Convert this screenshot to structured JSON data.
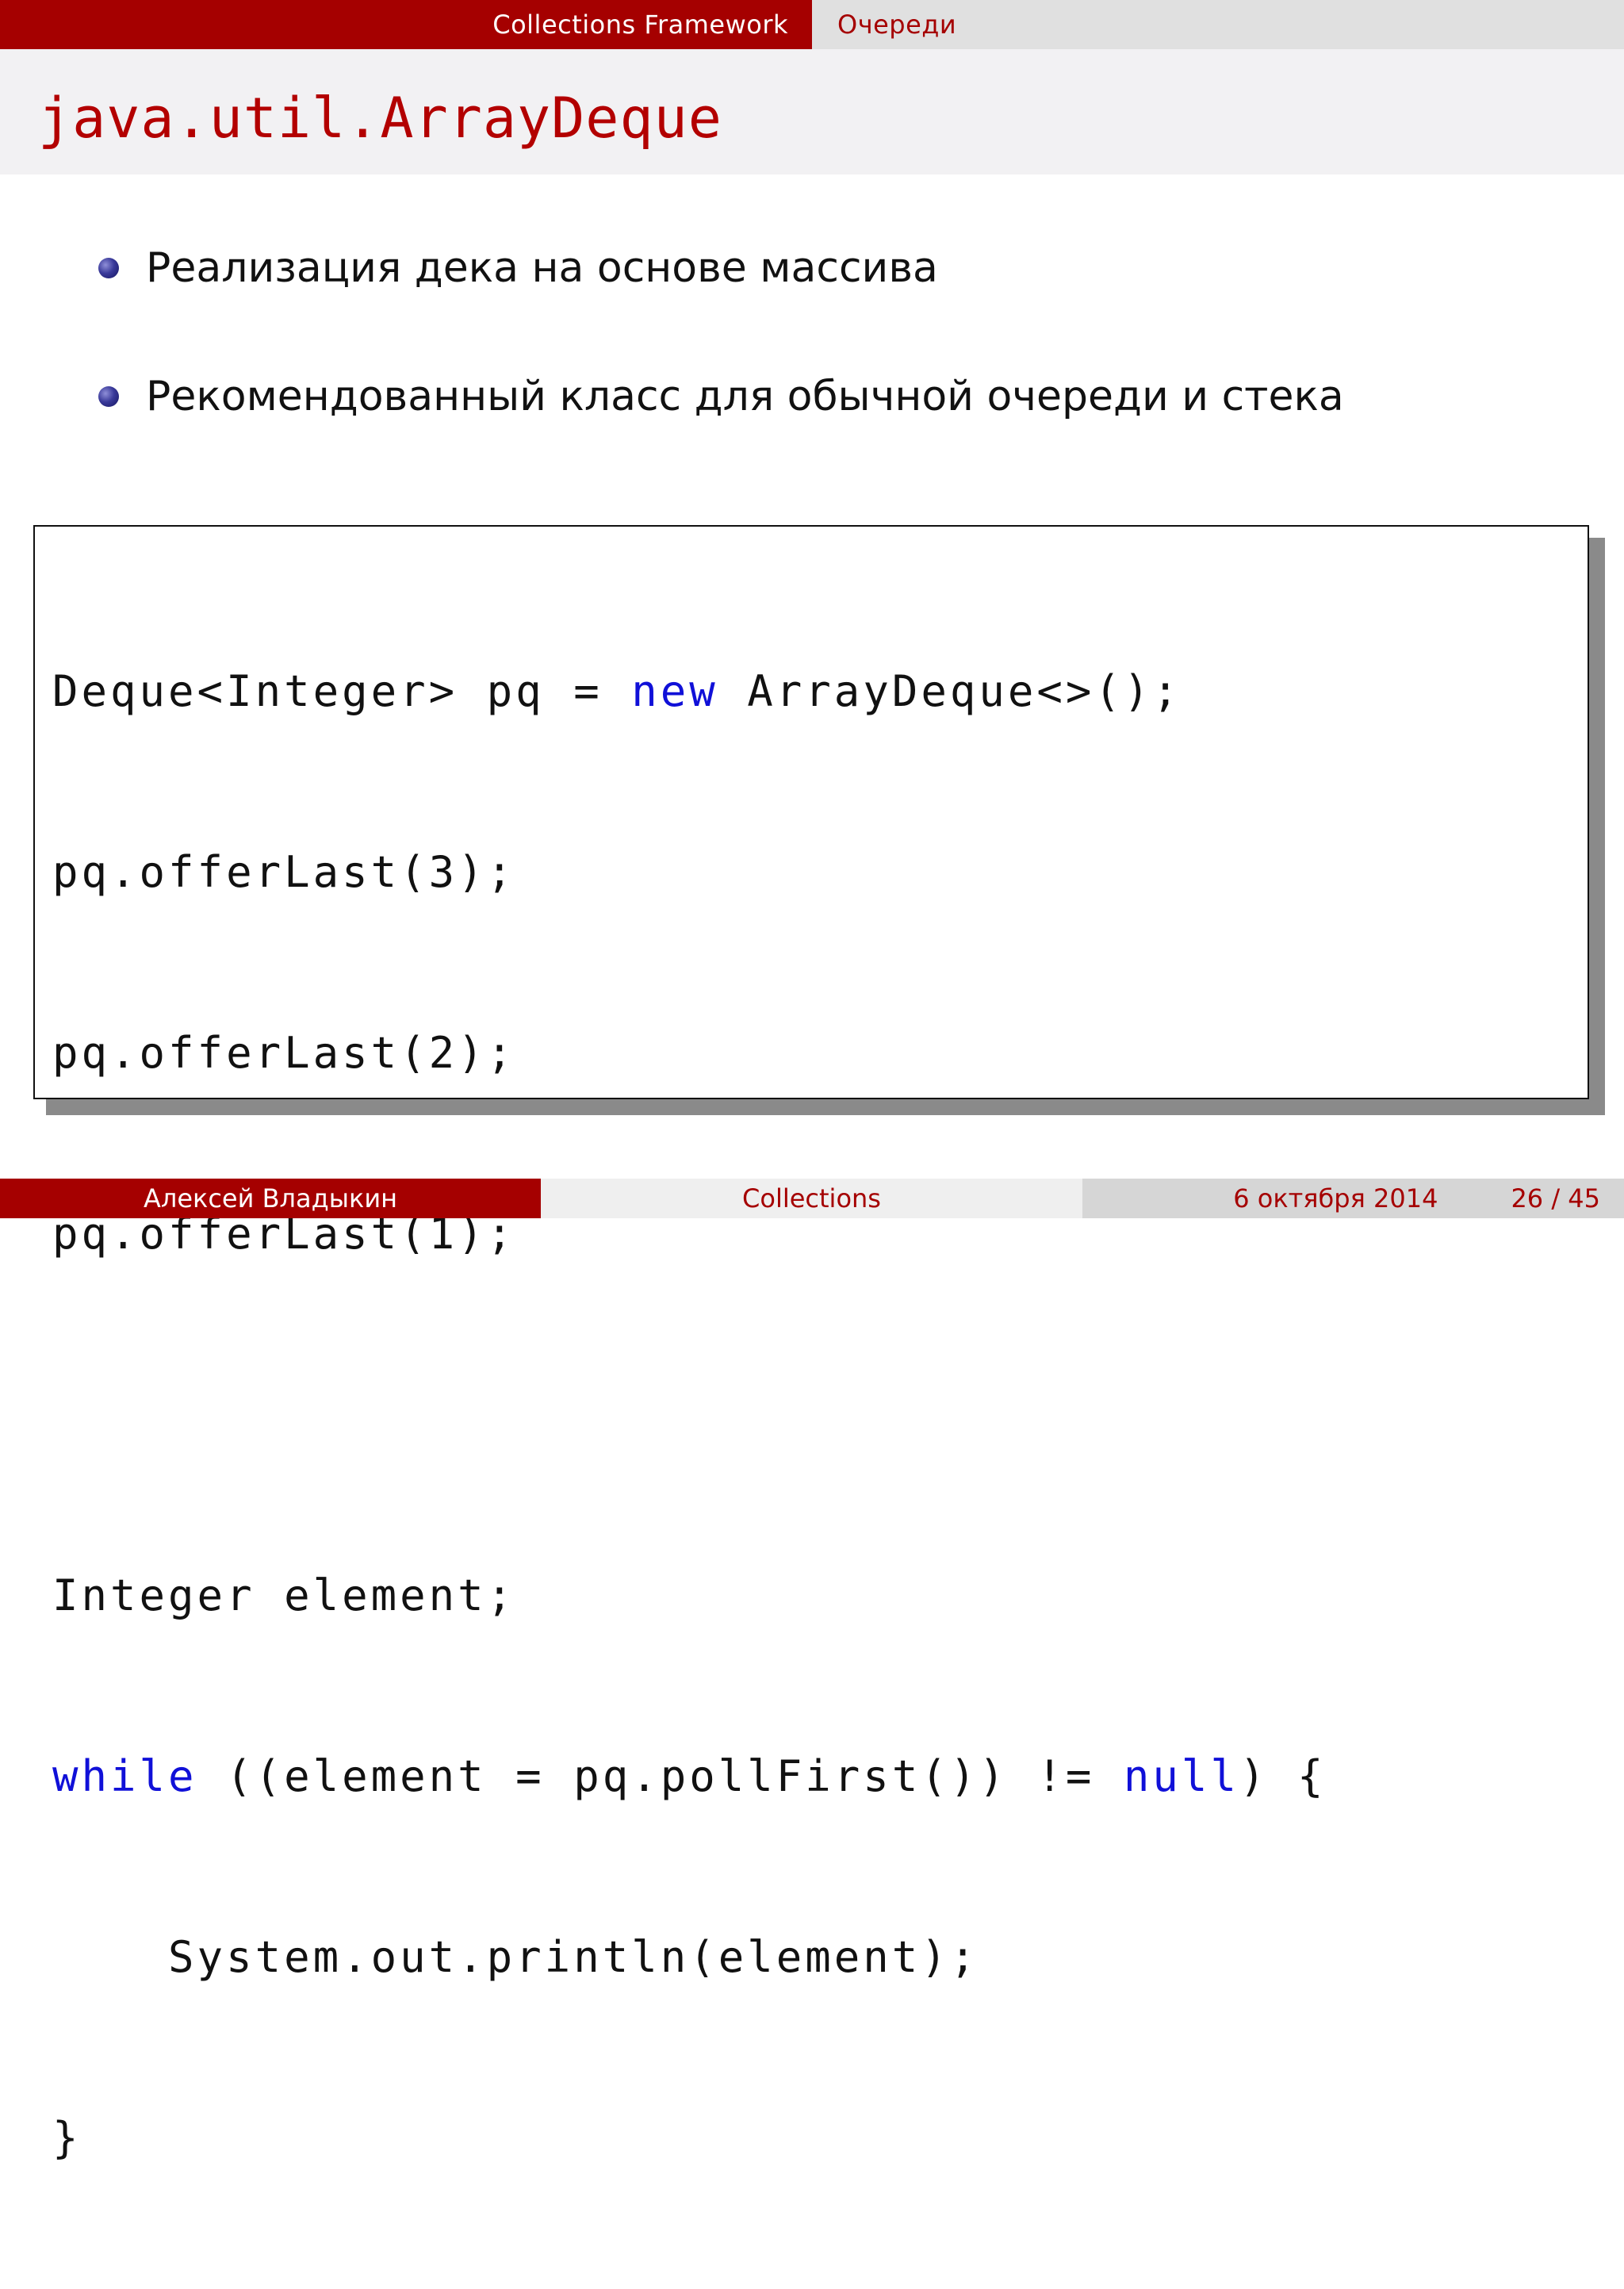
{
  "header": {
    "section": "Collections Framework",
    "subsection": "Очереди"
  },
  "slide": {
    "title": "java.util.ArrayDeque",
    "bullets": [
      "Реализация дека на основе массива",
      "Рекомендованный класс для обычной очереди и стека"
    ]
  },
  "code": {
    "l1_a": "Deque<Integer> pq = ",
    "l1_kw": "new",
    "l1_b": " ArrayDeque<>();",
    "l2": "pq.offerLast(3);",
    "l3": "pq.offerLast(2);",
    "l4": "pq.offerLast(1);",
    "l6": "Integer element;",
    "l7_kw1": "while",
    "l7_a": " ((element = pq.pollFirst()) != ",
    "l7_kw2": "null",
    "l7_b": ") {",
    "l8": "    System.out.println(element);",
    "l9": "}"
  },
  "footer": {
    "author": "Алексей Владыкин",
    "topic": "Collections",
    "date": "6 октября 2014",
    "page": "26 / 45"
  },
  "colors": {
    "accent_red": "#a50000",
    "keyword_blue": "#1010d8",
    "bullet_blue": "#3a3a9a"
  }
}
